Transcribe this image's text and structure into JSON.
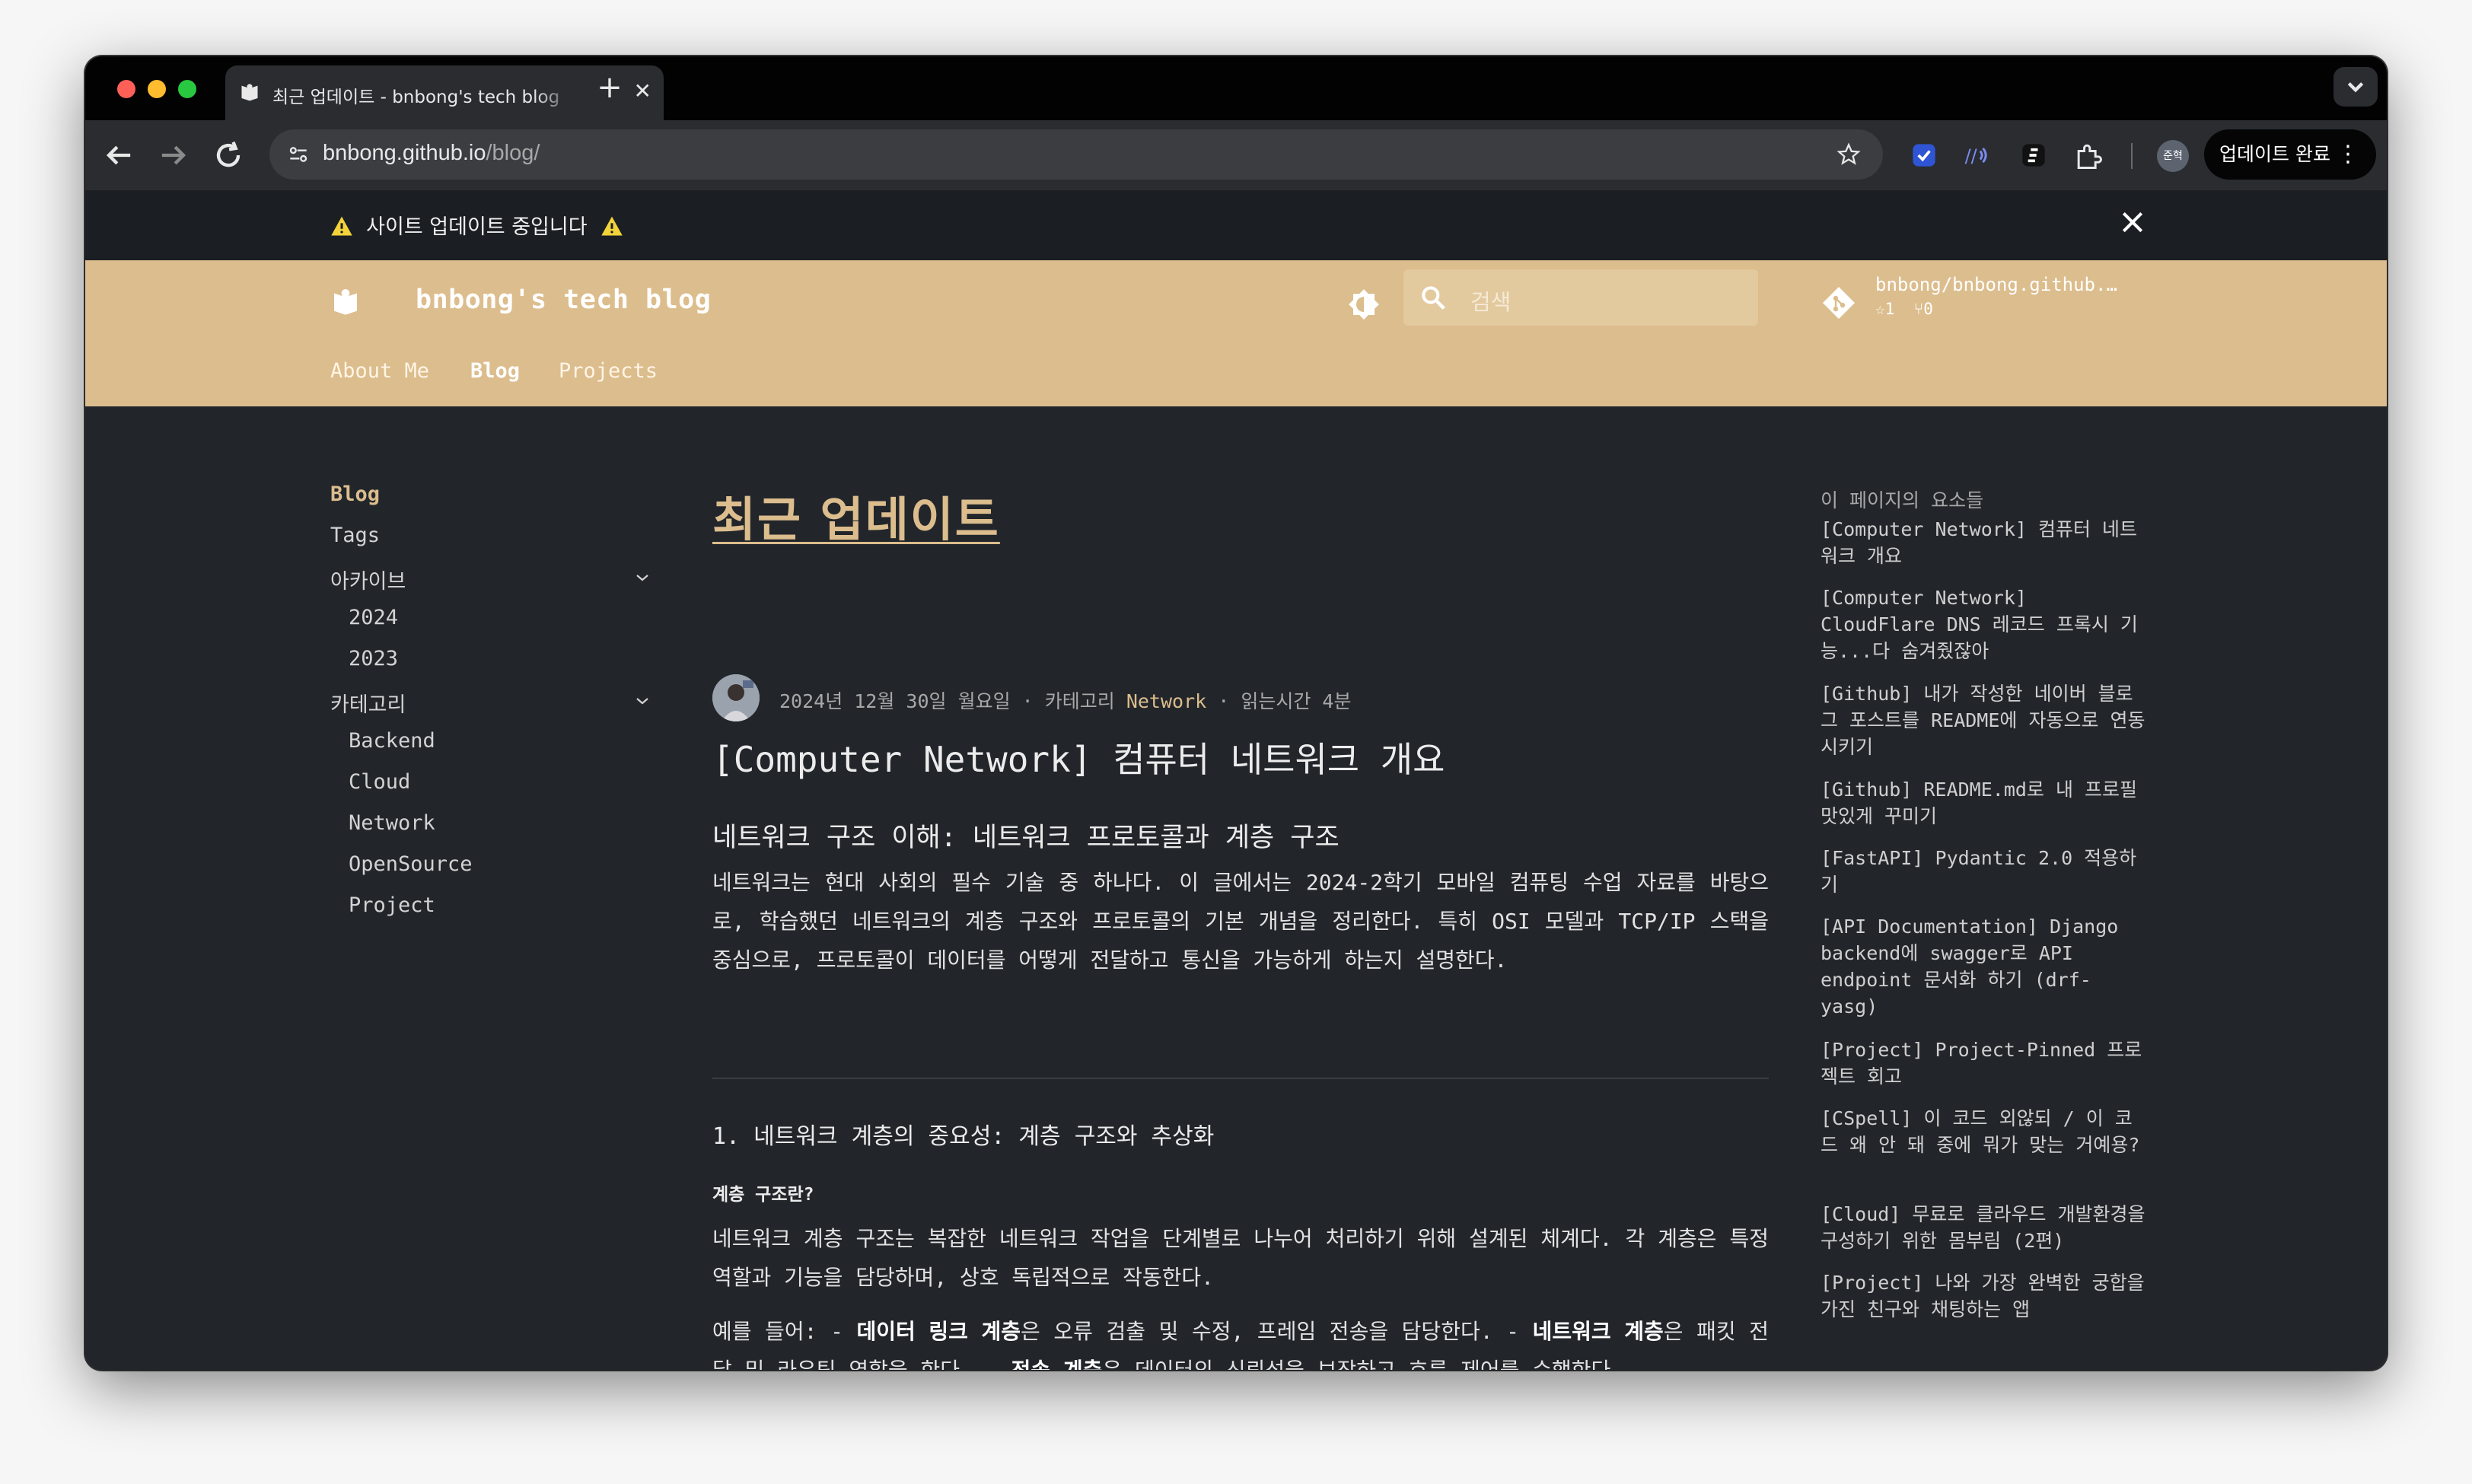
{
  "browser": {
    "tab_title": "최근 업데이트 - bnbong's tech blog",
    "url_host": "bnbong.github.io",
    "url_path": "/blog/",
    "profile_label": "준혁",
    "update_button": "업데이트 완료"
  },
  "announcement": {
    "text": "사이트 업데이트 중입니다"
  },
  "header": {
    "site_title": "bnbong's tech blog",
    "search_placeholder": "검색",
    "repo_name": "bnbong/bnbong.github.io",
    "repo_stars": "1",
    "repo_forks": "0",
    "nav": [
      "About Me",
      "Blog",
      "Projects"
    ],
    "accent": "#dcbd8d"
  },
  "sidebar": {
    "items": [
      {
        "label": "Blog"
      },
      {
        "label": "Tags"
      },
      {
        "label": "아카이브"
      },
      {
        "label": "2024"
      },
      {
        "label": "2023"
      },
      {
        "label": "카테고리"
      },
      {
        "label": "Backend"
      },
      {
        "label": "Cloud"
      },
      {
        "label": "Network"
      },
      {
        "label": "OpenSource"
      },
      {
        "label": "Project"
      }
    ]
  },
  "main": {
    "page_title": "최근 업데이트",
    "post": {
      "date": "2024년 12월 30일 월요일",
      "category_prefix": "· 카테고리",
      "category": "Network",
      "read_time": "· 읽는시간 4분",
      "title": "[Computer Network] 컴퓨터 네트워크 개요",
      "subtitle": "네트워크 구조 이해: 네트워크 프로토콜과 계층 구조",
      "intro": "네트워크는 현대 사회의 필수 기술 중 하나다. 이 글에서는 2024-2학기 모바일 컴퓨팅 수업 자료를 바탕으로, 학습했던 네트워크의 계층 구조와 프로토콜의 기본 개념을 정리한다. 특히 OSI 모델과 TCP/IP 스택을 중심으로, 프로토콜이 데이터를 어떻게 전달하고 통신을 가능하게 하는지 설명한다.",
      "section1_title": "1. 네트워크 계층의 중요성: 계층 구조와 추상화",
      "section1_sub": "계층 구조란?",
      "section1_para": "네트워크 계층 구조는 복잡한 네트워크 작업을 단계별로 나누어 처리하기 위해 설계된 체계다. 각 계층은 특정 역할과 기능을 담당하며, 상호 독립적으로 작동한다.",
      "ex_prefix": "예를 들어: - ",
      "ex_b1": "데이터 링크 계층",
      "ex_t1": "은 오류 검출 및 수정, 프레임 전송을 담당한다. - ",
      "ex_b2": "네트워크 계층",
      "ex_t2": "은 패킷 전달 및 라우팅 역할을 한다. - ",
      "ex_b3": "전송 계층",
      "ex_t3": "은 데이터의 신뢰성을 보장하고 흐름 제어를 수행한다."
    }
  },
  "toc": {
    "heading": "이 페이지의 요소들",
    "items": [
      "[Computer Network] 컴퓨터 네트워크 개요",
      "[Computer Network] CloudFlare DNS 레코드 프록시 기능...다 숨겨줬잖아",
      "[Github] 내가 작성한 네이버 블로그 포스트를 README에 자동으로 연동시키기",
      "[Github] README.md로 내 프로필 맛있게 꾸미기",
      "[FastAPI] Pydantic 2.0 적용하기",
      "[API Documentation] Django backend에 swagger로 API endpoint 문서화 하기 (drf-yasg)",
      "[Project] Project-Pinned 프로젝트 회고",
      "[CSpell] 이 코드 외않되 / 이 코드 왜 안 돼 중에 뭐가 맞는 거예용?",
      "[Cloud] 무료로 클라우드 개발환경을 구성하기 위한 몸부림 (2편)",
      "[Project] 나와 가장 완벽한 궁합을 가진 친구와 채팅하는 앱"
    ]
  }
}
